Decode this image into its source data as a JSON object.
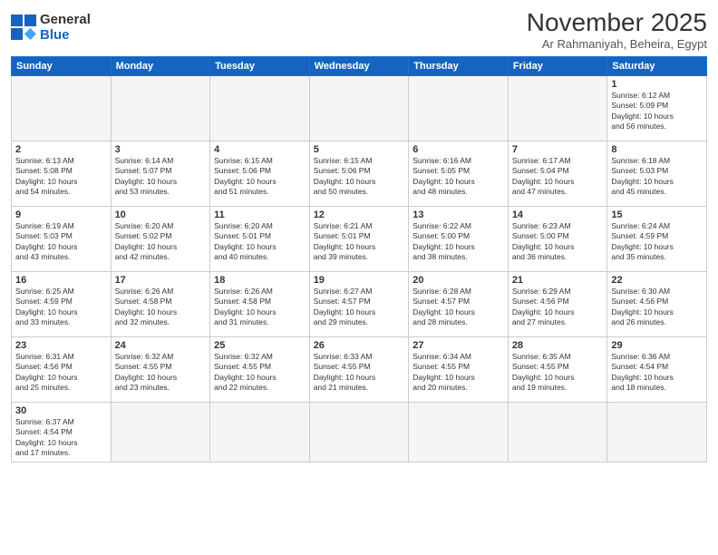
{
  "logo": {
    "general": "General",
    "blue": "Blue"
  },
  "title": "November 2025",
  "location": "Ar Rahmaniyah, Beheira, Egypt",
  "weekdays": [
    "Sunday",
    "Monday",
    "Tuesday",
    "Wednesday",
    "Thursday",
    "Friday",
    "Saturday"
  ],
  "weeks": [
    [
      {
        "day": "",
        "info": ""
      },
      {
        "day": "",
        "info": ""
      },
      {
        "day": "",
        "info": ""
      },
      {
        "day": "",
        "info": ""
      },
      {
        "day": "",
        "info": ""
      },
      {
        "day": "",
        "info": ""
      },
      {
        "day": "1",
        "info": "Sunrise: 6:12 AM\nSunset: 5:09 PM\nDaylight: 10 hours\nand 56 minutes."
      }
    ],
    [
      {
        "day": "2",
        "info": "Sunrise: 6:13 AM\nSunset: 5:08 PM\nDaylight: 10 hours\nand 54 minutes."
      },
      {
        "day": "3",
        "info": "Sunrise: 6:14 AM\nSunset: 5:07 PM\nDaylight: 10 hours\nand 53 minutes."
      },
      {
        "day": "4",
        "info": "Sunrise: 6:15 AM\nSunset: 5:06 PM\nDaylight: 10 hours\nand 51 minutes."
      },
      {
        "day": "5",
        "info": "Sunrise: 6:15 AM\nSunset: 5:06 PM\nDaylight: 10 hours\nand 50 minutes."
      },
      {
        "day": "6",
        "info": "Sunrise: 6:16 AM\nSunset: 5:05 PM\nDaylight: 10 hours\nand 48 minutes."
      },
      {
        "day": "7",
        "info": "Sunrise: 6:17 AM\nSunset: 5:04 PM\nDaylight: 10 hours\nand 47 minutes."
      },
      {
        "day": "8",
        "info": "Sunrise: 6:18 AM\nSunset: 5:03 PM\nDaylight: 10 hours\nand 45 minutes."
      }
    ],
    [
      {
        "day": "9",
        "info": "Sunrise: 6:19 AM\nSunset: 5:03 PM\nDaylight: 10 hours\nand 43 minutes."
      },
      {
        "day": "10",
        "info": "Sunrise: 6:20 AM\nSunset: 5:02 PM\nDaylight: 10 hours\nand 42 minutes."
      },
      {
        "day": "11",
        "info": "Sunrise: 6:20 AM\nSunset: 5:01 PM\nDaylight: 10 hours\nand 40 minutes."
      },
      {
        "day": "12",
        "info": "Sunrise: 6:21 AM\nSunset: 5:01 PM\nDaylight: 10 hours\nand 39 minutes."
      },
      {
        "day": "13",
        "info": "Sunrise: 6:22 AM\nSunset: 5:00 PM\nDaylight: 10 hours\nand 38 minutes."
      },
      {
        "day": "14",
        "info": "Sunrise: 6:23 AM\nSunset: 5:00 PM\nDaylight: 10 hours\nand 36 minutes."
      },
      {
        "day": "15",
        "info": "Sunrise: 6:24 AM\nSunset: 4:59 PM\nDaylight: 10 hours\nand 35 minutes."
      }
    ],
    [
      {
        "day": "16",
        "info": "Sunrise: 6:25 AM\nSunset: 4:59 PM\nDaylight: 10 hours\nand 33 minutes."
      },
      {
        "day": "17",
        "info": "Sunrise: 6:26 AM\nSunset: 4:58 PM\nDaylight: 10 hours\nand 32 minutes."
      },
      {
        "day": "18",
        "info": "Sunrise: 6:26 AM\nSunset: 4:58 PM\nDaylight: 10 hours\nand 31 minutes."
      },
      {
        "day": "19",
        "info": "Sunrise: 6:27 AM\nSunset: 4:57 PM\nDaylight: 10 hours\nand 29 minutes."
      },
      {
        "day": "20",
        "info": "Sunrise: 6:28 AM\nSunset: 4:57 PM\nDaylight: 10 hours\nand 28 minutes."
      },
      {
        "day": "21",
        "info": "Sunrise: 6:29 AM\nSunset: 4:56 PM\nDaylight: 10 hours\nand 27 minutes."
      },
      {
        "day": "22",
        "info": "Sunrise: 6:30 AM\nSunset: 4:56 PM\nDaylight: 10 hours\nand 26 minutes."
      }
    ],
    [
      {
        "day": "23",
        "info": "Sunrise: 6:31 AM\nSunset: 4:56 PM\nDaylight: 10 hours\nand 25 minutes."
      },
      {
        "day": "24",
        "info": "Sunrise: 6:32 AM\nSunset: 4:55 PM\nDaylight: 10 hours\nand 23 minutes."
      },
      {
        "day": "25",
        "info": "Sunrise: 6:32 AM\nSunset: 4:55 PM\nDaylight: 10 hours\nand 22 minutes."
      },
      {
        "day": "26",
        "info": "Sunrise: 6:33 AM\nSunset: 4:55 PM\nDaylight: 10 hours\nand 21 minutes."
      },
      {
        "day": "27",
        "info": "Sunrise: 6:34 AM\nSunset: 4:55 PM\nDaylight: 10 hours\nand 20 minutes."
      },
      {
        "day": "28",
        "info": "Sunrise: 6:35 AM\nSunset: 4:55 PM\nDaylight: 10 hours\nand 19 minutes."
      },
      {
        "day": "29",
        "info": "Sunrise: 6:36 AM\nSunset: 4:54 PM\nDaylight: 10 hours\nand 18 minutes."
      }
    ],
    [
      {
        "day": "30",
        "info": "Sunrise: 6:37 AM\nSunset: 4:54 PM\nDaylight: 10 hours\nand 17 minutes."
      },
      {
        "day": "",
        "info": ""
      },
      {
        "day": "",
        "info": ""
      },
      {
        "day": "",
        "info": ""
      },
      {
        "day": "",
        "info": ""
      },
      {
        "day": "",
        "info": ""
      },
      {
        "day": "",
        "info": ""
      }
    ]
  ]
}
